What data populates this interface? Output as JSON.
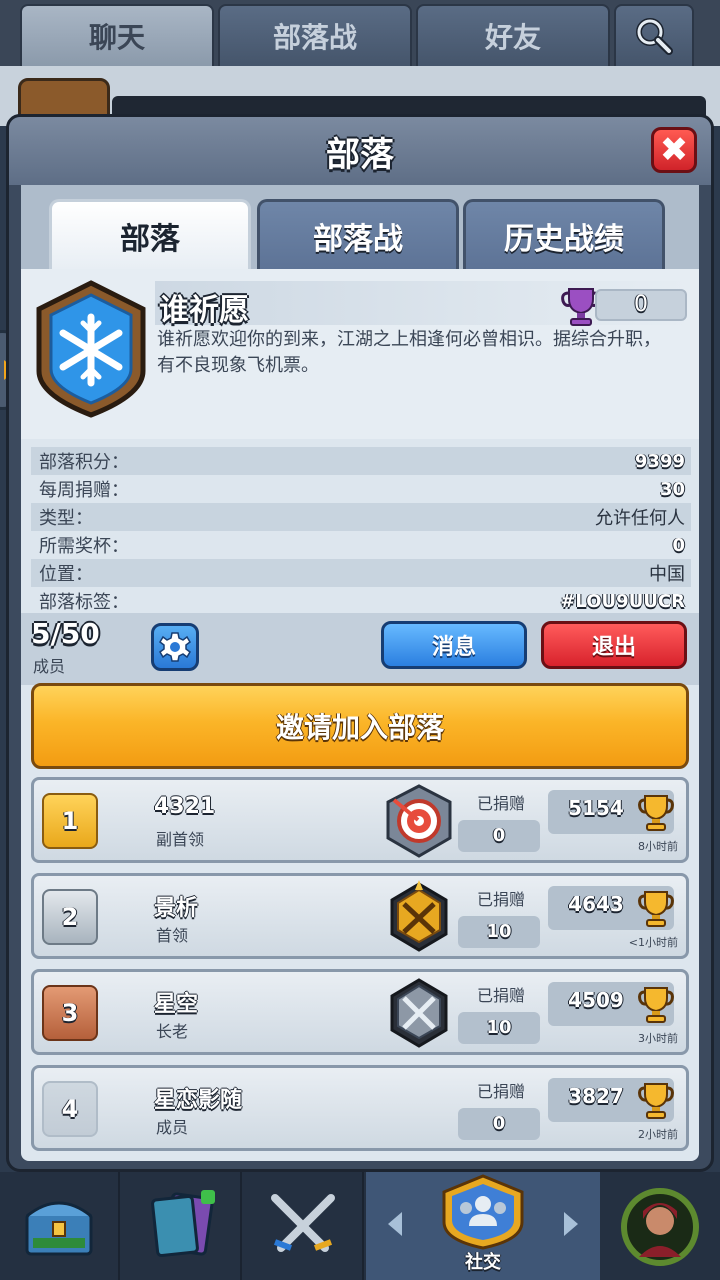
{
  "top_tabs": [
    "聊天",
    "部落战",
    "好友"
  ],
  "panel": {
    "title": "部落",
    "close": "✖"
  },
  "sub_tabs": [
    "部落",
    "部落战",
    "历史战绩"
  ],
  "clan": {
    "name": "谁祈愿",
    "trophies": "0",
    "description": "谁祈愿欢迎你的到来，江湖之上相逢何必曾相识。据综合升职，有不良现象飞机票。"
  },
  "stats": [
    {
      "label": "部落积分：",
      "value": "9399"
    },
    {
      "label": "每周捐赠：",
      "value": "30"
    },
    {
      "label": "类型：",
      "value": "允许任何人"
    },
    {
      "label": "所需奖杯：",
      "value": "0"
    },
    {
      "label": "位置：",
      "value": "中国"
    },
    {
      "label": "部落标签：",
      "value": "#LOU9UUCR"
    }
  ],
  "members_bar": {
    "count": "5/50",
    "label": "成员",
    "message_btn": "消息",
    "leave_btn": "退出"
  },
  "invite_btn": "邀请加入部落",
  "members": [
    {
      "rank": "1",
      "name": "4321",
      "role": "副首领",
      "donated_label": "已捐赠",
      "donated": "0",
      "trophies": "5154",
      "last_seen": "8小时前"
    },
    {
      "rank": "2",
      "name": "景析",
      "role": "首领",
      "donated_label": "已捐赠",
      "donated": "10",
      "trophies": "4643",
      "last_seen": "<1小时前"
    },
    {
      "rank": "3",
      "name": "星空",
      "role": "长老",
      "donated_label": "已捐赠",
      "donated": "10",
      "trophies": "4509",
      "last_seen": "3小时前"
    },
    {
      "rank": "4",
      "name": "星恋影随",
      "role": "成员",
      "donated_label": "已捐赠",
      "donated": "0",
      "trophies": "3827",
      "last_seen": "2小时前"
    }
  ],
  "bottom_nav": {
    "social_label": "社交"
  },
  "colors": {
    "accent_gold": "#f39c12",
    "blue_button": "#2b7fe0",
    "red_button": "#d8222c",
    "panel_bg": "#dde6ee"
  }
}
